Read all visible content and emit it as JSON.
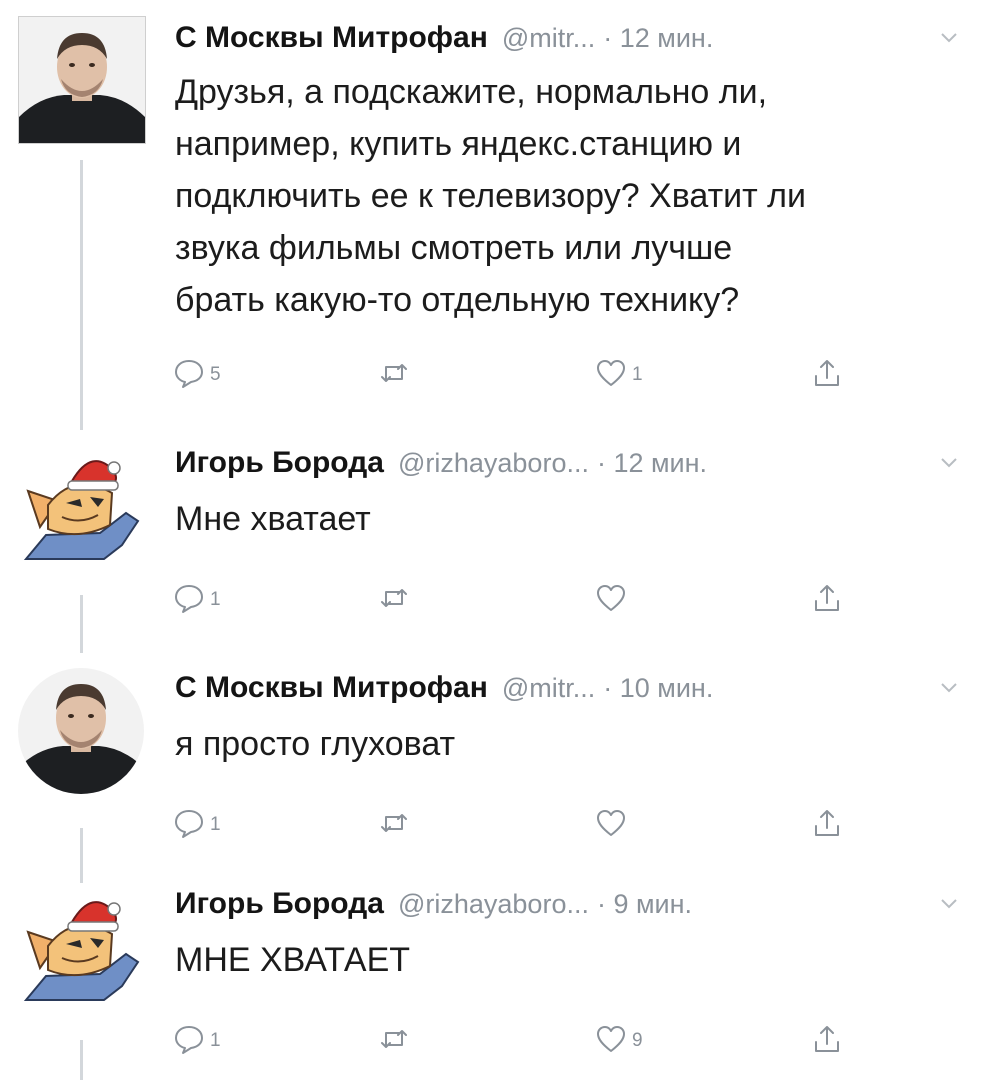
{
  "tweets": [
    {
      "author": "С Москвы Митрофан",
      "handle": "@mitr...",
      "time": "· 12 мин.",
      "lines": [
        "Друзья, а подскажите, нормально ли,",
        "например, купить яндекс.станцию и",
        "подключить ее к телевизору? Хватит ли",
        "звука фильмы смотреть или лучше",
        "брать какую-то отдельную технику?"
      ],
      "replies": "5",
      "retweets": "",
      "likes": "1"
    },
    {
      "author": "Игорь Борода",
      "handle": "@rizhayaboro...",
      "time": "· 12 мин.",
      "lines": [
        "Мне хватает"
      ],
      "replies": "1",
      "retweets": "",
      "likes": ""
    },
    {
      "author": "С Москвы Митрофан",
      "handle": "@mitr...",
      "time": "· 10 мин.",
      "lines": [
        "я просто глуховат"
      ],
      "replies": "1",
      "retweets": "",
      "likes": ""
    },
    {
      "author": "Игорь Борода",
      "handle": "@rizhayaboro...",
      "time": "· 9 мин.",
      "lines": [
        "МНЕ ХВАТАЕТ"
      ],
      "replies": "1",
      "retweets": "",
      "likes": "9"
    }
  ],
  "icons": {
    "reply": "reply-icon",
    "retweet": "retweet-icon",
    "like": "heart-icon",
    "share": "share-icon",
    "menu": "chevron-down-icon"
  },
  "colors": {
    "text": "#1c1c1c",
    "muted": "#8a9199",
    "thread_line": "#d3d7db"
  }
}
